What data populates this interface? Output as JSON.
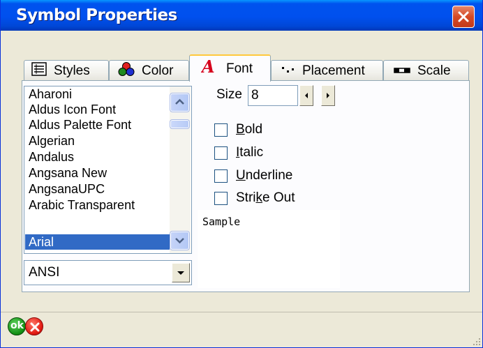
{
  "window": {
    "title": "Symbol Properties"
  },
  "tabs": [
    {
      "label": "Styles",
      "icon": "list-icon"
    },
    {
      "label": "Color",
      "icon": "color-circles-icon"
    },
    {
      "label": "Font",
      "icon": "font-a-icon"
    },
    {
      "label": "Placement",
      "icon": "placement-dots-icon"
    },
    {
      "label": "Scale",
      "icon": "scale-bar-icon"
    }
  ],
  "active_tab": "Font",
  "font_list": {
    "items": [
      "Aharoni",
      "Aldus Icon Font",
      "Aldus Palette Font",
      "Algerian",
      "Andalus",
      "Angsana New",
      "AngsanaUPC",
      "Arabic Transparent",
      "Arial"
    ],
    "selected": "Arial"
  },
  "charset": {
    "value": "ANSI"
  },
  "size": {
    "label": "Size",
    "value": "8"
  },
  "styles": {
    "bold": {
      "pre": "",
      "key": "B",
      "post": "old",
      "checked": false
    },
    "italic": {
      "pre": "",
      "key": "I",
      "post": "talic",
      "checked": false
    },
    "underline": {
      "pre": "",
      "key": "U",
      "post": "nderline",
      "checked": false
    },
    "strikeout": {
      "pre": "Stri",
      "key": "k",
      "post": "e Out",
      "checked": false
    }
  },
  "sample": {
    "text": "Sample"
  },
  "buttons": {
    "ok": "ok"
  },
  "colors": {
    "titlebar": "#0050EE",
    "dialog_bg": "#ECE9D8",
    "selection": "#316AC5",
    "font_icon": "#D6001C"
  }
}
